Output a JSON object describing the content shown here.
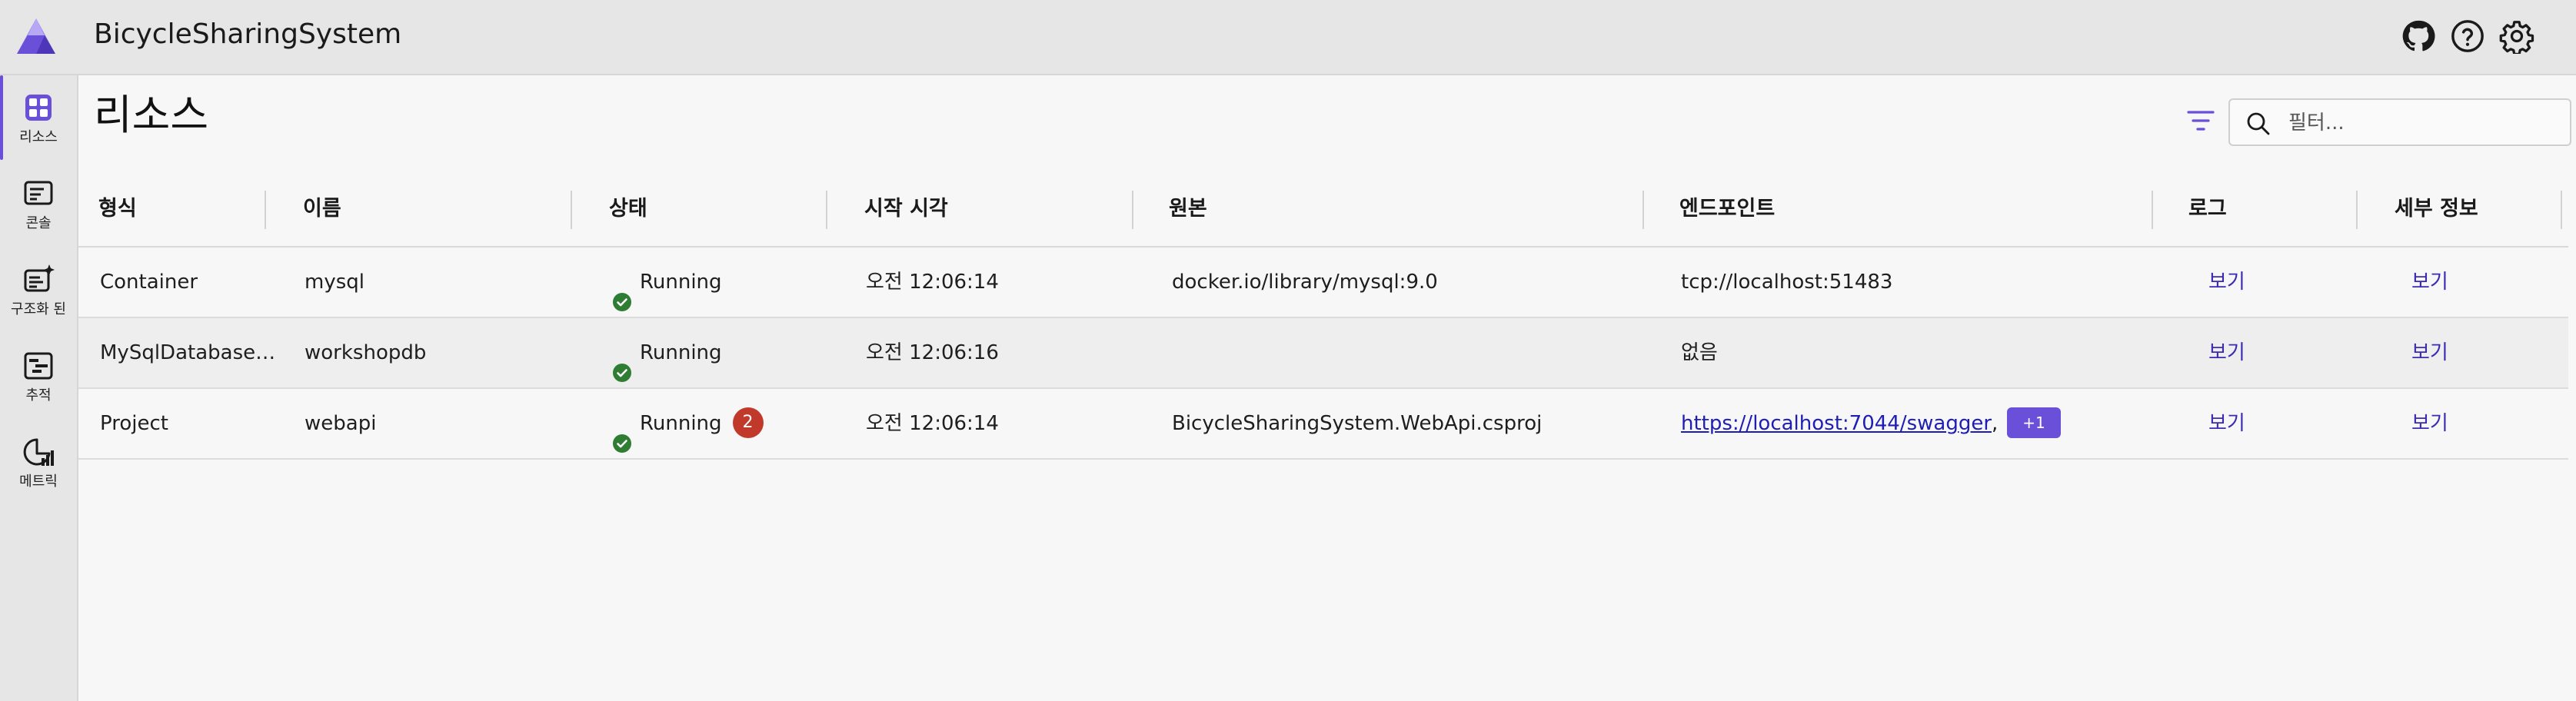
{
  "app": {
    "title": "BicycleSharingSystem"
  },
  "sidebar": {
    "items": [
      {
        "label": "리소스",
        "icon": "grid-icon",
        "active": true
      },
      {
        "label": "콘솔",
        "icon": "console-icon"
      },
      {
        "label": "구조화 된",
        "icon": "structured-logs-icon"
      },
      {
        "label": "추적",
        "icon": "traces-icon"
      },
      {
        "label": "메트릭",
        "icon": "metrics-icon"
      }
    ]
  },
  "page": {
    "title": "리소스",
    "search": {
      "placeholder": "필터...",
      "value": ""
    }
  },
  "table": {
    "columns": [
      "형식",
      "이름",
      "상태",
      "시작 시각",
      "원본",
      "엔드포인트",
      "로그",
      "세부 정보"
    ],
    "rows": [
      {
        "type": "Container",
        "name": "mysql",
        "state": "Running",
        "errors": "",
        "start": "오전 12:06:14",
        "source": "docker.io/library/mysql:9.0",
        "endpoint": "tcp://localhost:51483",
        "endpoint_is_link": false,
        "endpoint_extra": "",
        "logs": "보기",
        "details": "보기"
      },
      {
        "type": "MySqlDatabase…",
        "name": "workshopdb",
        "state": "Running",
        "errors": "",
        "start": "오전 12:06:16",
        "source": "",
        "endpoint": "없음",
        "endpoint_is_link": false,
        "endpoint_extra": "",
        "logs": "보기",
        "details": "보기"
      },
      {
        "type": "Project",
        "name": "webapi",
        "state": "Running",
        "errors": "2",
        "start": "오전 12:06:14",
        "source": "BicycleSharingSystem.WebApi.csproj",
        "endpoint": "https://localhost:7044/swagger",
        "endpoint_is_link": true,
        "endpoint_extra": "+1",
        "logs": "보기",
        "details": "보기"
      }
    ]
  },
  "colors": {
    "accent": "#6a4fd9",
    "running": "#2e7d32",
    "error_badge": "#c0392b",
    "link": "#3b2bb3"
  }
}
